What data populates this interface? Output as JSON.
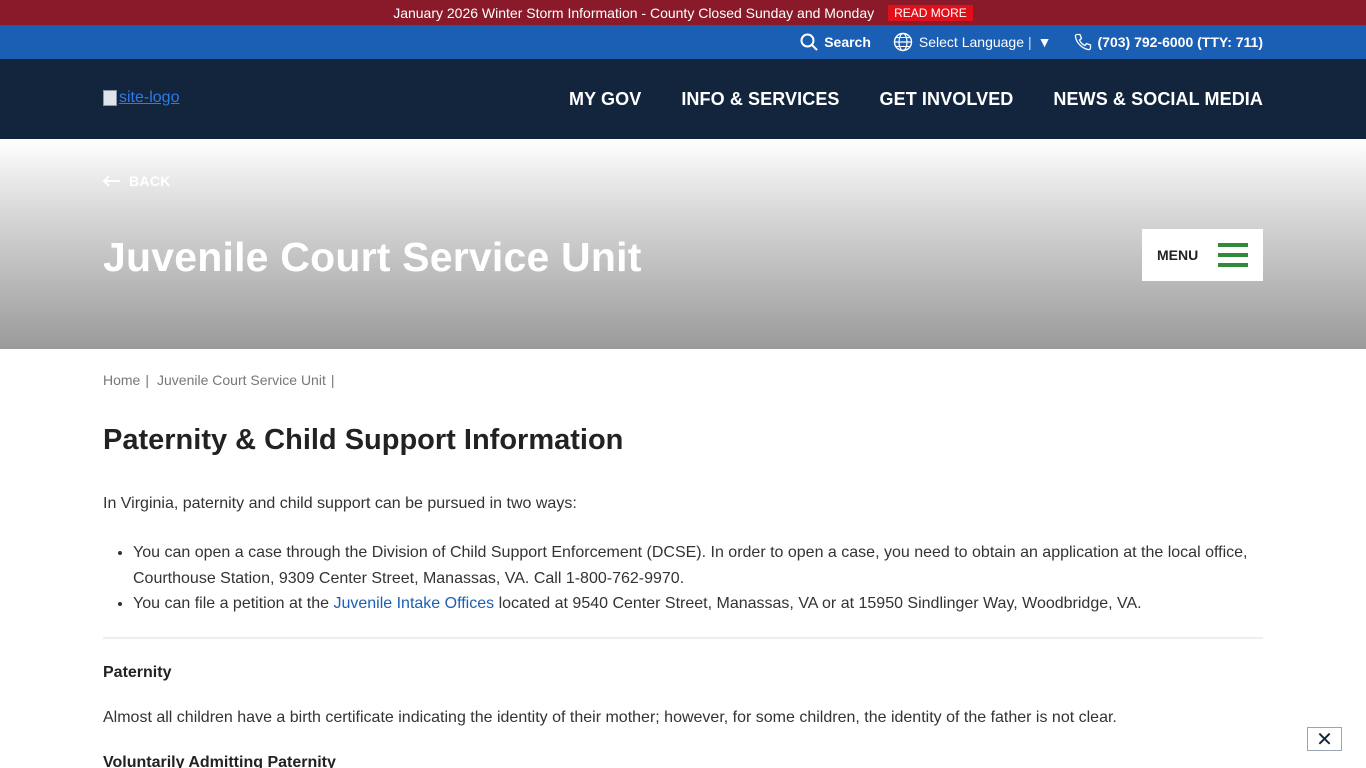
{
  "alert": {
    "text": "January 2026 Winter Storm Information - County Closed Sunday and Monday",
    "read_more": "READ MORE"
  },
  "utility": {
    "search_label": "Search",
    "language_label": "Select Language",
    "language_sep": "|",
    "language_arrow": "▼",
    "phone": "(703) 792-6000 (TTY: 711)"
  },
  "nav": {
    "logo_alt": "site-logo",
    "links": [
      "MY GOV",
      "INFO & SERVICES",
      "GET INVOLVED",
      "NEWS & SOCIAL MEDIA"
    ]
  },
  "hero": {
    "back_label": "BACK",
    "title": "Juvenile Court Service Unit",
    "menu_label": "MENU"
  },
  "breadcrumb": {
    "items": [
      "Home",
      "Juvenile Court Service Unit"
    ],
    "separator": "|"
  },
  "main": {
    "title": "Paternity & Child Support Information",
    "intro": "In Virginia, paternity and child support can be pursued in two ways:",
    "bullet1": "You can open a case through the Division of Child Support Enforcement (DCSE). In order to open a case, you need to obtain an application at the local office, Courthouse Station, 9309 Center Street, Manassas, VA. Call 1-800-762-9970.",
    "bullet2_before": "You can file a petition at the ",
    "bullet2_link": "Juvenile Intake Offices",
    "bullet2_after": " located at 9540 Center Street, Manassas, VA or at 15950 Sindlinger Way, Woodbridge, VA.",
    "paternity_heading": "Paternity",
    "paternity_text": "Almost all children have a birth certificate indicating the identity of their mother; however, for some children, the identity of the father is not clear.",
    "voluntary_heading": "Voluntarily Admitting Paternity"
  },
  "close_label": "✕",
  "colors": {
    "alert_bg": "#8a1a2a",
    "read_more_bg": "#e0101a",
    "utility_bg": "#1a5fb4",
    "nav_bg": "#12253d",
    "hamburger": "#2f8a3a",
    "link": "#1a5fb4"
  }
}
